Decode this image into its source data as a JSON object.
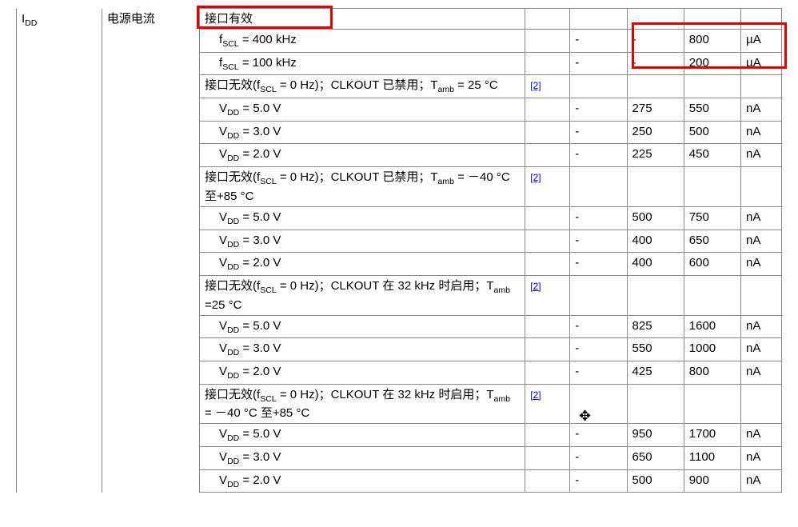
{
  "symbol_html": "I<span class='sub'>DD</span>",
  "param": "电源电流",
  "heading1": "接口有效",
  "r_fscl400": {
    "cond_html": "f<span class='sub'>SCL</span> = 400 kHz",
    "min": "-",
    "typ": "-",
    "max": "800",
    "unit": "µA"
  },
  "r_fscl100": {
    "cond_html": "f<span class='sub'>SCL</span> = 100 kHz",
    "min": "-",
    "typ": "-",
    "max": "200",
    "unit": "µA"
  },
  "headingA_html": "接口无效(f<span class='sub'>SCL</span> = 0 Hz)；CLKOUT 已禁用；T<span class='sub'>amb</span> = 25 °C",
  "note2": "[2]",
  "grpA": {
    "v5": {
      "cond_html": "V<span class='sub'>DD</span> = 5.0 V",
      "min": "-",
      "typ": "275",
      "max": "550",
      "unit": "nA"
    },
    "v3": {
      "cond_html": "V<span class='sub'>DD</span> = 3.0 V",
      "min": "-",
      "typ": "250",
      "max": "500",
      "unit": "nA"
    },
    "v2": {
      "cond_html": "V<span class='sub'>DD</span> = 2.0 V",
      "min": "-",
      "typ": "225",
      "max": "450",
      "unit": "nA"
    }
  },
  "headingB_html": "接口无效(f<span class='sub'>SCL</span> = 0 Hz)；CLKOUT 已禁用；T<span class='sub'>amb</span> = －40 °C 至+85 °C",
  "grpB": {
    "v5": {
      "cond_html": "V<span class='sub'>DD</span> = 5.0 V",
      "min": "-",
      "typ": "500",
      "max": "750",
      "unit": "nA"
    },
    "v3": {
      "cond_html": "V<span class='sub'>DD</span> = 3.0 V",
      "min": "-",
      "typ": "400",
      "max": "650",
      "unit": "nA"
    },
    "v2": {
      "cond_html": "V<span class='sub'>DD</span> = 2.0 V",
      "min": "-",
      "typ": "400",
      "max": "600",
      "unit": "nA"
    }
  },
  "headingC_html": "接口无效(f<span class='sub'>SCL</span> = 0 Hz)；CLKOUT 在 32 kHz 时启用；T<span class='sub'>amb</span> =25 °C",
  "grpC": {
    "v5": {
      "cond_html": "V<span class='sub'>DD</span> = 5.0 V",
      "min": "-",
      "typ": "825",
      "max": "1600",
      "unit": "nA"
    },
    "v3": {
      "cond_html": "V<span class='sub'>DD</span> = 3.0 V",
      "min": "-",
      "typ": "550",
      "max": "1000",
      "unit": "nA"
    },
    "v2": {
      "cond_html": "V<span class='sub'>DD</span> = 2.0 V",
      "min": "-",
      "typ": "425",
      "max": "800",
      "unit": "nA"
    }
  },
  "headingD_html": "接口无效(f<span class='sub'>SCL</span> = 0 Hz)；CLKOUT 在 32 kHz 时启用；T<span class='sub'>amb</span> = －40 °C 至+85 °C",
  "grpD": {
    "v5": {
      "cond_html": "V<span class='sub'>DD</span> = 5.0 V",
      "min": "-",
      "typ": "950",
      "max": "1700",
      "unit": "nA"
    },
    "v3": {
      "cond_html": "V<span class='sub'>DD</span> = 3.0 V",
      "min": "-",
      "typ": "650",
      "max": "1100",
      "unit": "nA"
    },
    "v2": {
      "cond_html": "V<span class='sub'>DD</span> = 2.0 V",
      "min": "-",
      "typ": "500",
      "max": "900",
      "unit": "nA"
    }
  }
}
